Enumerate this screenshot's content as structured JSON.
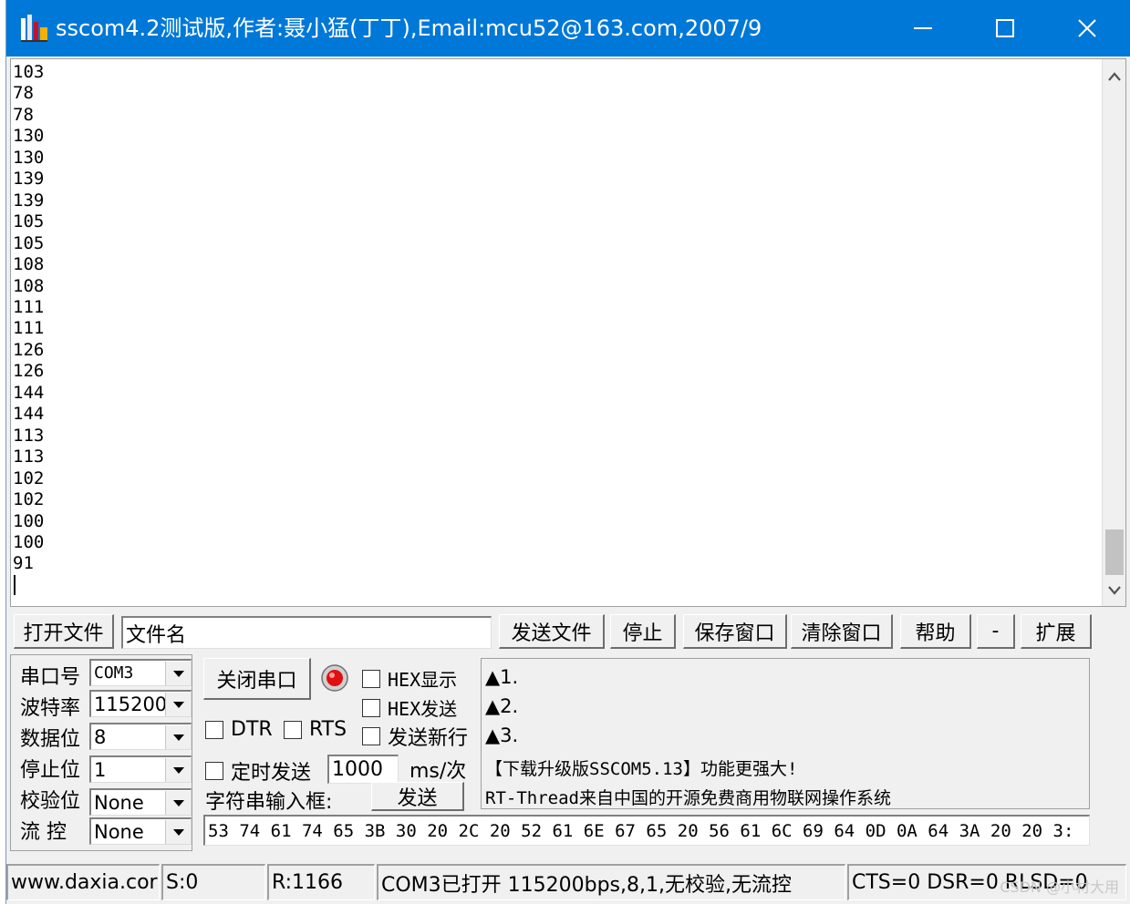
{
  "window": {
    "title": "sscom4.2测试版,作者:聂小猛(丁丁),Email:mcu52@163.com,2007/9"
  },
  "output": {
    "lines": [
      "103",
      "78",
      "78",
      "130",
      "130",
      "139",
      "139",
      "105",
      "105",
      "108",
      "108",
      "111",
      "111",
      "126",
      "126",
      "144",
      "144",
      "113",
      "113",
      "102",
      "102",
      "100",
      "100",
      "91"
    ]
  },
  "toolbar": {
    "open_file_label": "打开文件",
    "file_name_value": "文件名",
    "send_file_label": "发送文件",
    "stop_label": "停止",
    "save_window_label": "保存窗口",
    "clear_window_label": "清除窗口",
    "help_label": "帮助",
    "minus_label": "-",
    "expand_label": "扩展"
  },
  "config": {
    "port_label": "串口号",
    "port_value": "COM3",
    "baud_label": "波特率",
    "baud_value": "115200",
    "databits_label": "数据位",
    "databits_value": "8",
    "stopbits_label": "停止位",
    "stopbits_value": "1",
    "parity_label": "校验位",
    "parity_value": "None",
    "flow_label": "流 控",
    "flow_value": "None"
  },
  "controls": {
    "close_port_label": "关闭串口",
    "hex_display_label": "HEX显示",
    "hex_send_label": "HEX发送",
    "send_newline_label": "发送新行",
    "dtr_label": "DTR",
    "rts_label": "RTS",
    "timed_send_label": "定时发送",
    "interval_value": "1000",
    "interval_unit": "ms/次",
    "input_label": "字符串输入框:",
    "send_label": "发送",
    "send_input_value": "53 74 61 74 65 3B 30 20 2C 20 52 61 6E 67 65 20 56 61 6C 69 64 0D 0A 64 3A 20 20 3:"
  },
  "info": {
    "line1": "▲1.",
    "line2": "▲2.",
    "line3": "▲3.",
    "line4": "【下载升级版SSCOM5.13】功能更强大!",
    "line5": "RT-Thread来自中国的开源免费商用物联网操作系统"
  },
  "status": {
    "website": "www.daxia.cor",
    "sent": "S:0",
    "received": "R:1166",
    "port_state": "COM3已打开  115200bps,8,1,无校验,无流控",
    "signals": "CTS=0 DSR=0 RLSD=0"
  },
  "watermark": "CSDN @小材大用",
  "colors": {
    "titlebar": "#0078d7",
    "face": "#f0f0f0"
  }
}
